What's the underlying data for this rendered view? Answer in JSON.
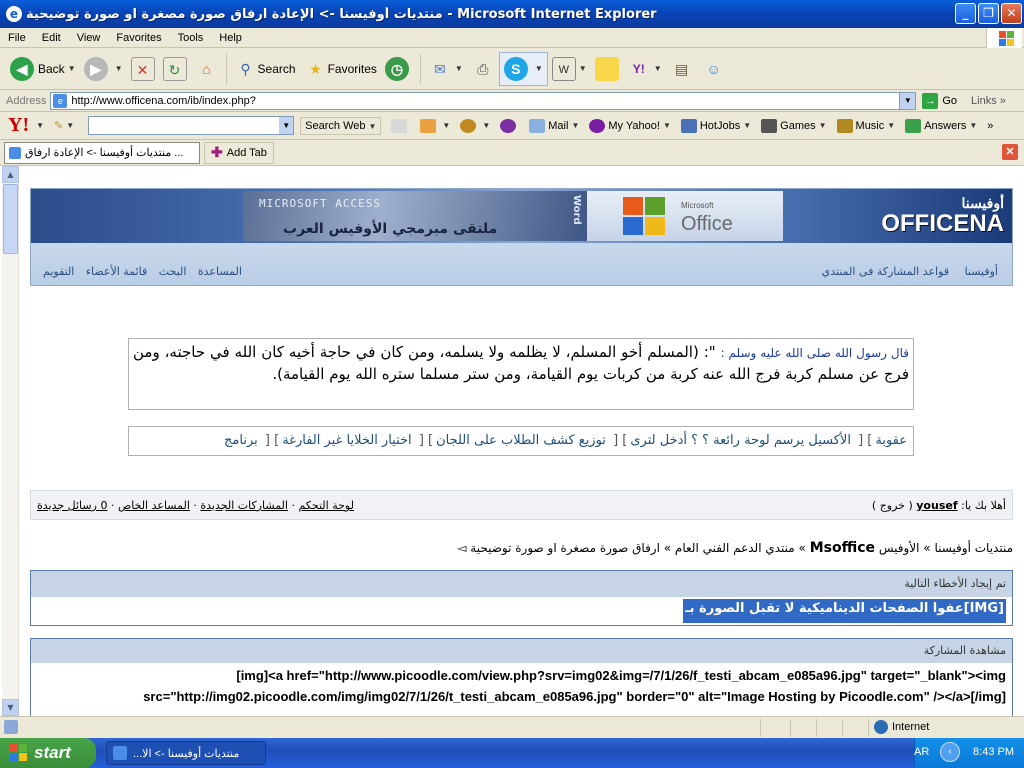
{
  "window": {
    "title": "منتديات أوفيسنا -> الإعادة ارفاق صورة مصغرة او صورة توضيحية - Microsoft Internet Explorer"
  },
  "menu": [
    "File",
    "Edit",
    "View",
    "Favorites",
    "Tools",
    "Help"
  ],
  "toolbar": {
    "back": "Back",
    "search": "Search",
    "favorites": "Favorites"
  },
  "address": {
    "label": "Address",
    "url": "http://www.officena.com/ib/index.php?",
    "go": "Go",
    "links": "Links"
  },
  "yahoo": {
    "logo": "Y!",
    "search_web": "Search Web",
    "mail": "Mail",
    "my_yahoo": "My Yahoo!",
    "hotjobs": "HotJobs",
    "games": "Games",
    "music": "Music",
    "answers": "Answers"
  },
  "tabs": {
    "active": "منتديات أوفيسنا -> الإعادة ارفاق ...",
    "add_tab": "Add Tab"
  },
  "banner": {
    "access_text": "MICROSOFT ACCESS",
    "slogan": "ملتقى مبرمجي الأوفيس العرب",
    "word_text": "Word",
    "office_small": "Microsoft",
    "office_big": "Office",
    "site_ar": "أوفيسنا",
    "site_en": "OFFICENA"
  },
  "nav": {
    "right": [
      "أوفيسنا",
      "قواعد المشاركة فى المنتدي"
    ],
    "left": [
      "المساعدة",
      "البحث",
      "قائمة الأعضاء",
      "التقويم"
    ]
  },
  "quote": {
    "intro": "قال رسول الله صلى الله عليه وسلم :",
    "text": "\": (المسلم أخو المسلم، لا يظلمه ولا يسلمه، ومن كان في حاجة أخيه كان الله في حاجته، ومن فرج عن مسلم كربة فرج الله عنه كربة من كربات يوم القيامة، ومن ستر مسلما ستره الله يوم القيامة)."
  },
  "links": [
    "عقوبة",
    "الأكسيل يرسم لوحة رائعة ؟ ؟ أدخل لترى",
    "توزيع كشف الطلاب على اللجان",
    "اختيار الخلايا غير الفارغة",
    "برنامج"
  ],
  "userbar": {
    "welcome": "أهلا بك يا:",
    "username": "yousef",
    "logout": "( خروج )",
    "control_panel": "لوحة التحكم",
    "posts_link": "المشاركات الجديدة",
    "assistant": "المساعد الخاص",
    "messages": "0 رسائل جديدة"
  },
  "breadcrumb": {
    "p1": "منتديات أوفيسنا",
    "p2": "الأوفيس",
    "p3": "Msoffice",
    "p4": "منتدي الدعم الفني العام",
    "p5": "ارفاق صورة مصغرة او صورة توضيحية"
  },
  "errors": {
    "header": "تم إيجاد الأخطاء التالية",
    "message": "[IMG]عفوا الصفحات الديناميكية لا تقبل الصورة بـ"
  },
  "preview": {
    "header": "مشاهدة المشاركة",
    "line1": "img]<a href=\"http://www.picoodle.com/view.php?srv=img02&img=/7/1/26/f_testi_abcam_e085a96.jpg\" target=\"_blank\"><img]",
    "line2": "[src=\"http://img02.picoodle.com/img/img02/7/1/26/t_testi_abcam_e085a96.jpg\" border=\"0\" alt=\"Image Hosting by Picoodle.com\" /></a>[/img"
  },
  "status": {
    "zone": "Internet"
  },
  "taskbar": {
    "start": "start",
    "task": "...منتديات أوفيسنا -> الا",
    "lang": "AR",
    "clock": "8:43 PM"
  }
}
